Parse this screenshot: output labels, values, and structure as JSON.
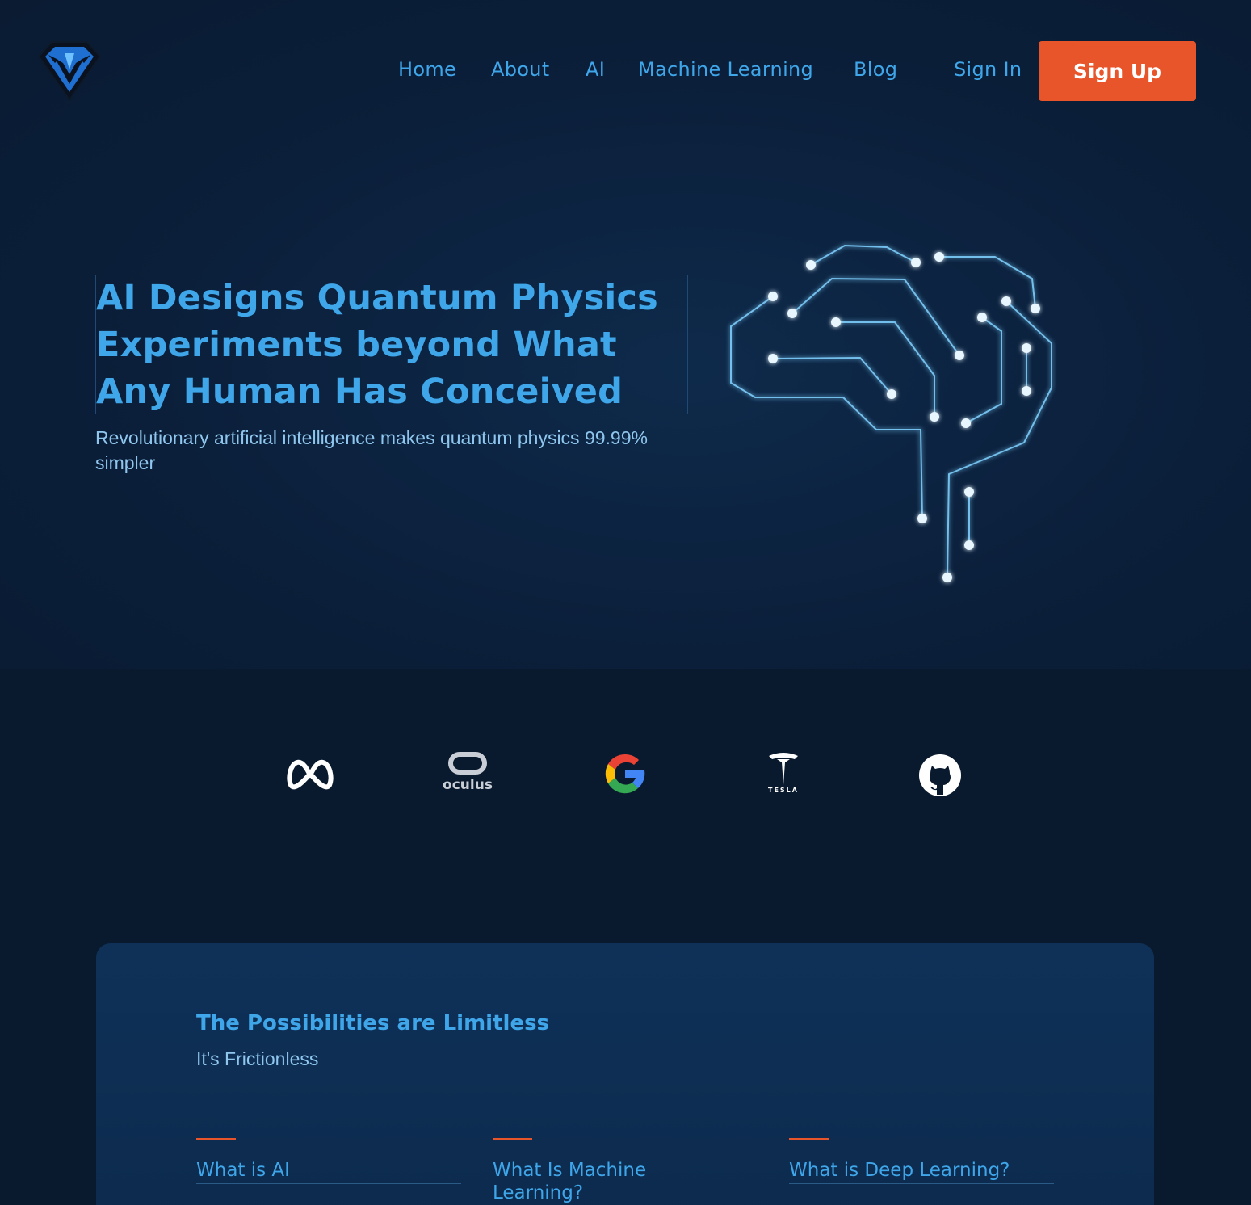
{
  "nav": {
    "items": [
      {
        "label": "Home"
      },
      {
        "label": "About"
      },
      {
        "label": "AI"
      },
      {
        "label": "Machine Learning"
      },
      {
        "label": "Blog"
      }
    ],
    "signin_label": "Sign In",
    "signup_label": "Sign Up"
  },
  "hero": {
    "title": "AI Designs Quantum Physics Experiments beyond What Any Human Has Conceived",
    "subtitle": "Revolutionary artificial intelligence makes quantum physics 99.99% simpler"
  },
  "partners": {
    "oculus_text": "oculus",
    "tesla_text": "TESLA"
  },
  "features_section": {
    "title": "The Possibilities are Limitless",
    "subtitle": "It's Frictionless",
    "items": [
      {
        "title": "What is AI"
      },
      {
        "title": "What Is Machine Learning?"
      },
      {
        "title": "What is Deep Learning?"
      }
    ]
  },
  "colors": {
    "accent": "#3fa6ea",
    "cta": "#e8552b",
    "background": "#0b1c33"
  }
}
